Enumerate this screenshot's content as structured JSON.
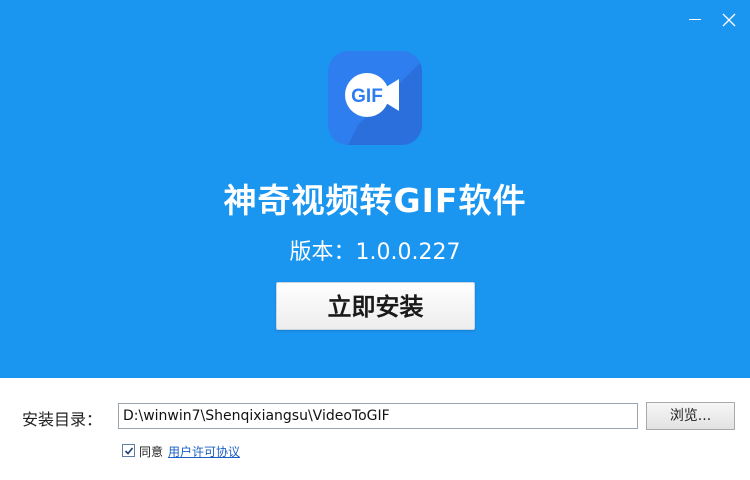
{
  "window": {
    "minimize_icon": "minimize-icon",
    "close_icon": "close-icon"
  },
  "logo": {
    "text": "GIF",
    "icon": "video-camera-icon",
    "color": "#2f7ef0"
  },
  "app": {
    "title": "神奇视频转GIF软件",
    "version": "版本：1.0.0.227"
  },
  "install": {
    "button_label": "立即安装"
  },
  "directory": {
    "label": "安装目录：",
    "value": "D:\\winwin7\\Shenqixiangsu\\VideoToGIF",
    "browse_label": "浏览..."
  },
  "agreement": {
    "checked": true,
    "agree_text": "同意",
    "link_text": "用户许可协议"
  },
  "colors": {
    "hero_background": "#1a95f0",
    "link": "#1a5fc4"
  }
}
